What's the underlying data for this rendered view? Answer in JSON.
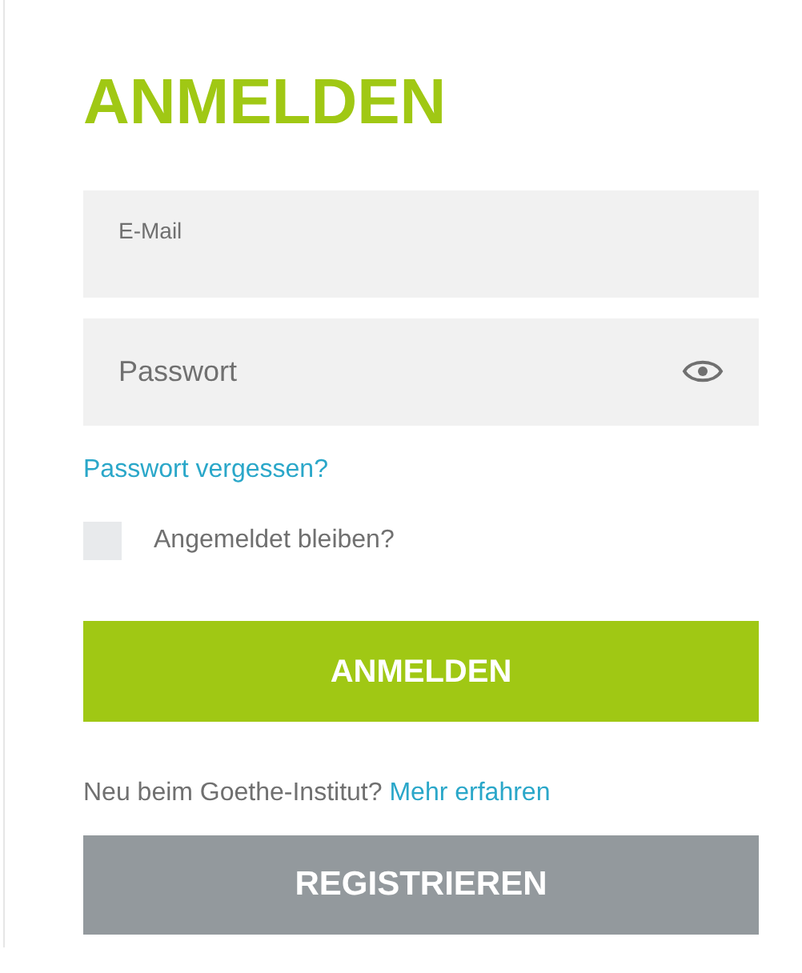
{
  "title": "ANMELDEN",
  "fields": [
    {
      "kind": "floating",
      "label": "E-Mail"
    },
    {
      "kind": "password",
      "placeholder": "Passwort"
    }
  ],
  "forgot_link": "Passwort vergessen?",
  "remember": {
    "label": "Angemeldet bleiben?",
    "checked": false
  },
  "login_button": "ANMELDEN",
  "register_prompt": {
    "text": "Neu beim Goethe-Institut?",
    "link": "Mehr erfahren"
  },
  "register_button": "REGISTRIEREN"
}
